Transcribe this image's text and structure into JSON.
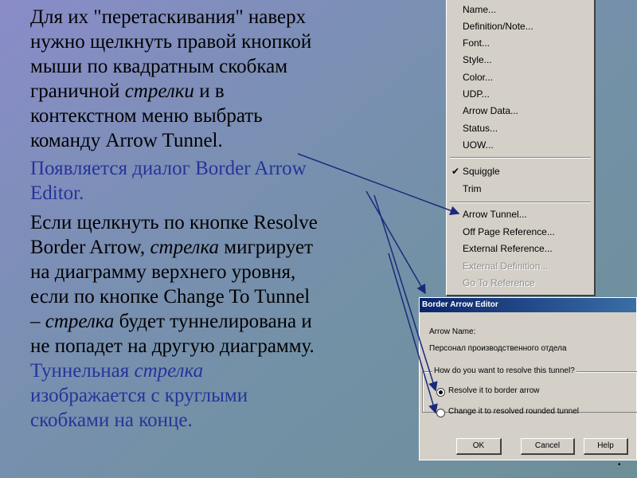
{
  "slide": {
    "p1": {
      "l1": "Для их \"перетаскивания\" наверх",
      "l2": "нужно щелкнуть правой кнопкой",
      "l3": "мыши по квадратным скобкам",
      "l4a": "граничной ",
      "l4b": "стрелки",
      "l4c": " и в",
      "l5": "контекстном меню выбрать",
      "l6": "команду   Arrow   Tunnel."
    },
    "p2": {
      "l1": "Появляется диалог Border Arrow",
      "l2": "Editor."
    },
    "p3": {
      "l1": "Если щелкнуть по кнопке Resolve",
      "l2a": "Border Arrow, ",
      "l2b": "стрелка",
      "l2c": " мигрирует",
      "l3": "на диаграмму верхнего уровня,",
      "l4": "если по кнопке Change To Tunnel",
      "l5a": "– ",
      "l5b": "стрелка",
      "l5c": " будет туннелирована и",
      "l6": "не попадет на другую диаграмму.",
      "l7a": "Туннельная ",
      "l7b": "стрелка",
      "l8": "изображается с круглыми",
      "l9": "скобками на конце."
    }
  },
  "context_menu": {
    "items": [
      {
        "label": "Name...",
        "disabled": false
      },
      {
        "label": "Definition/Note...",
        "disabled": false
      },
      {
        "label": "Font...",
        "disabled": false
      },
      {
        "label": "Style...",
        "disabled": false
      },
      {
        "label": "Color...",
        "disabled": false
      },
      {
        "label": "UDP...",
        "disabled": false
      },
      {
        "label": "Arrow Data...",
        "disabled": false
      },
      {
        "label": "Status...",
        "disabled": false
      },
      {
        "label": "UOW...",
        "disabled": false
      },
      {
        "label": "Squiggle",
        "disabled": false,
        "checked": true
      },
      {
        "label": "Trim",
        "disabled": false
      },
      {
        "label": "Arrow Tunnel...",
        "disabled": false
      },
      {
        "label": "Off Page Reference...",
        "disabled": false
      },
      {
        "label": "External Reference...",
        "disabled": false
      },
      {
        "label": "External Definition...",
        "disabled": true
      },
      {
        "label": "Go To Reference",
        "disabled": true
      }
    ],
    "check_glyph": "✔"
  },
  "dialog": {
    "title": "Border Arrow Editor",
    "arrow_name_label": "Arrow Name:",
    "arrow_name_value": "Персонал производственного отдела",
    "group_title": "How do you want to resolve this tunnel?",
    "option1": "Resolve it to border arrow",
    "option2": "Change it to resolved rounded tunnel",
    "selected_option": 1,
    "buttons": {
      "ok": "OK",
      "cancel": "Cancel",
      "help": "Help"
    }
  },
  "colors": {
    "accent_text": "#26349a",
    "arrow_line": "#1a2a7a"
  }
}
